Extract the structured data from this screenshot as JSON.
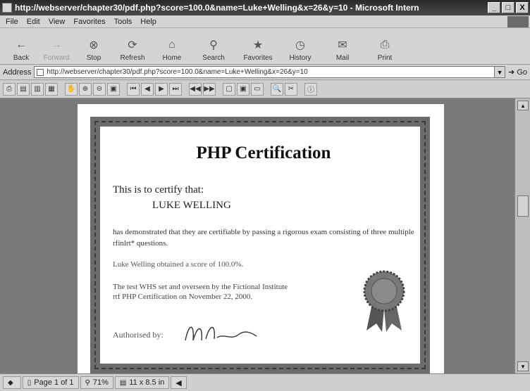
{
  "window": {
    "title": "http://webserver/chapter30/pdf.php?score=100.0&name=Luke+Welling&x=26&y=10 - Microsoft Intern",
    "minimize": "_",
    "maximize": "□",
    "close": "X"
  },
  "menu": {
    "items": [
      "File",
      "Edit",
      "View",
      "Favorites",
      "Tools",
      "Help"
    ]
  },
  "toolbar": {
    "buttons": [
      {
        "label": "Back",
        "icon": "back-arrow",
        "enabled": true
      },
      {
        "label": "Forward",
        "icon": "forward-arrow",
        "enabled": false
      },
      {
        "label": "Stop",
        "icon": "stop",
        "enabled": true
      },
      {
        "label": "Refresh",
        "icon": "refresh",
        "enabled": true
      },
      {
        "label": "Home",
        "icon": "home",
        "enabled": true
      },
      {
        "label": "Search",
        "icon": "search",
        "enabled": true
      },
      {
        "label": "Favorites",
        "icon": "favorites",
        "enabled": true
      },
      {
        "label": "History",
        "icon": "history",
        "enabled": true
      },
      {
        "label": "Mail",
        "icon": "mail",
        "enabled": true
      },
      {
        "label": "Print",
        "icon": "print",
        "enabled": true
      }
    ]
  },
  "address": {
    "label": "Address",
    "url": "http://webserver/chapter30/pdf.php?score=100.0&name=Luke+Welling&x=26&y=10",
    "go": "Go"
  },
  "certificate": {
    "title": "PHP Certification",
    "certify": "This is to certify that:",
    "name": "LUKE WELLING",
    "desc": "has demonstrated that they are certifiable by passing a rigorous exam consisting of three multiple rfinlrt* questions.",
    "score": "Luke Welling obtained a score of 100.0%.",
    "test": "The test WHS set and overseen by the Fictional Institute rtf PHP Certification on November 22, 2000.",
    "authorised": "Authorised by:"
  },
  "status": {
    "page": "Page 1 of 1",
    "zoom": "71%",
    "size": "11 x 8.5 in"
  }
}
